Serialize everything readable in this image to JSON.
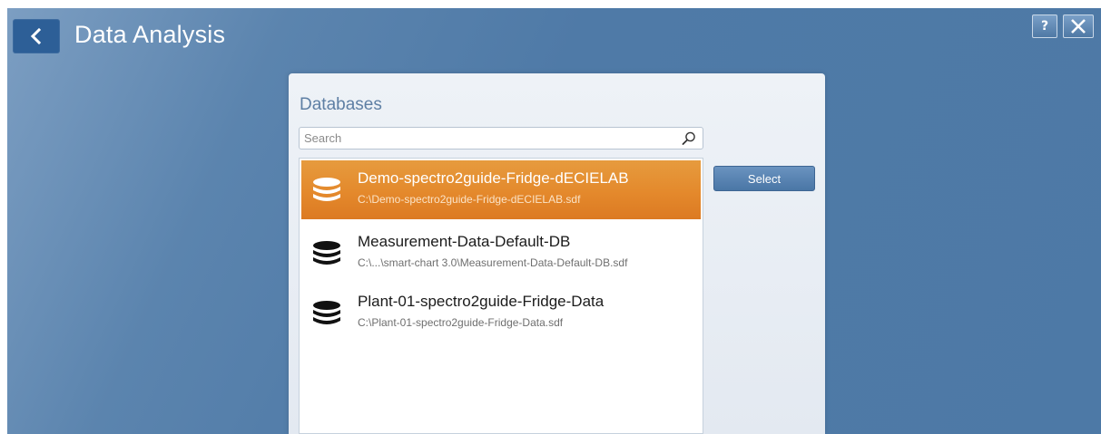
{
  "header": {
    "title": "Data Analysis",
    "help_label": "?"
  },
  "panel": {
    "title": "Databases",
    "search_placeholder": "Search",
    "search_value": "",
    "select_label": "Select"
  },
  "databases": [
    {
      "name": "Demo-spectro2guide-Fridge-dECIELAB",
      "path": "C:\\Demo-spectro2guide-Fridge-dECIELAB.sdf",
      "selected": true
    },
    {
      "name": "Measurement-Data-Default-DB",
      "path": "C:\\...\\smart-chart 3.0\\Measurement-Data-Default-DB.sdf",
      "selected": false
    },
    {
      "name": "Plant-01-spectro2guide-Fridge-Data",
      "path": "C:\\Plant-01-spectro2guide-Fridge-Data.sdf",
      "selected": false
    }
  ],
  "icons": {
    "back": "chevron-left-icon",
    "help": "question-icon",
    "close": "close-icon",
    "search": "search-icon",
    "database": "database-icon"
  },
  "colors": {
    "background": "#4d79a6",
    "selection": "#e4892c",
    "panel_title": "#5e7fa4",
    "button": "#5682b2"
  }
}
